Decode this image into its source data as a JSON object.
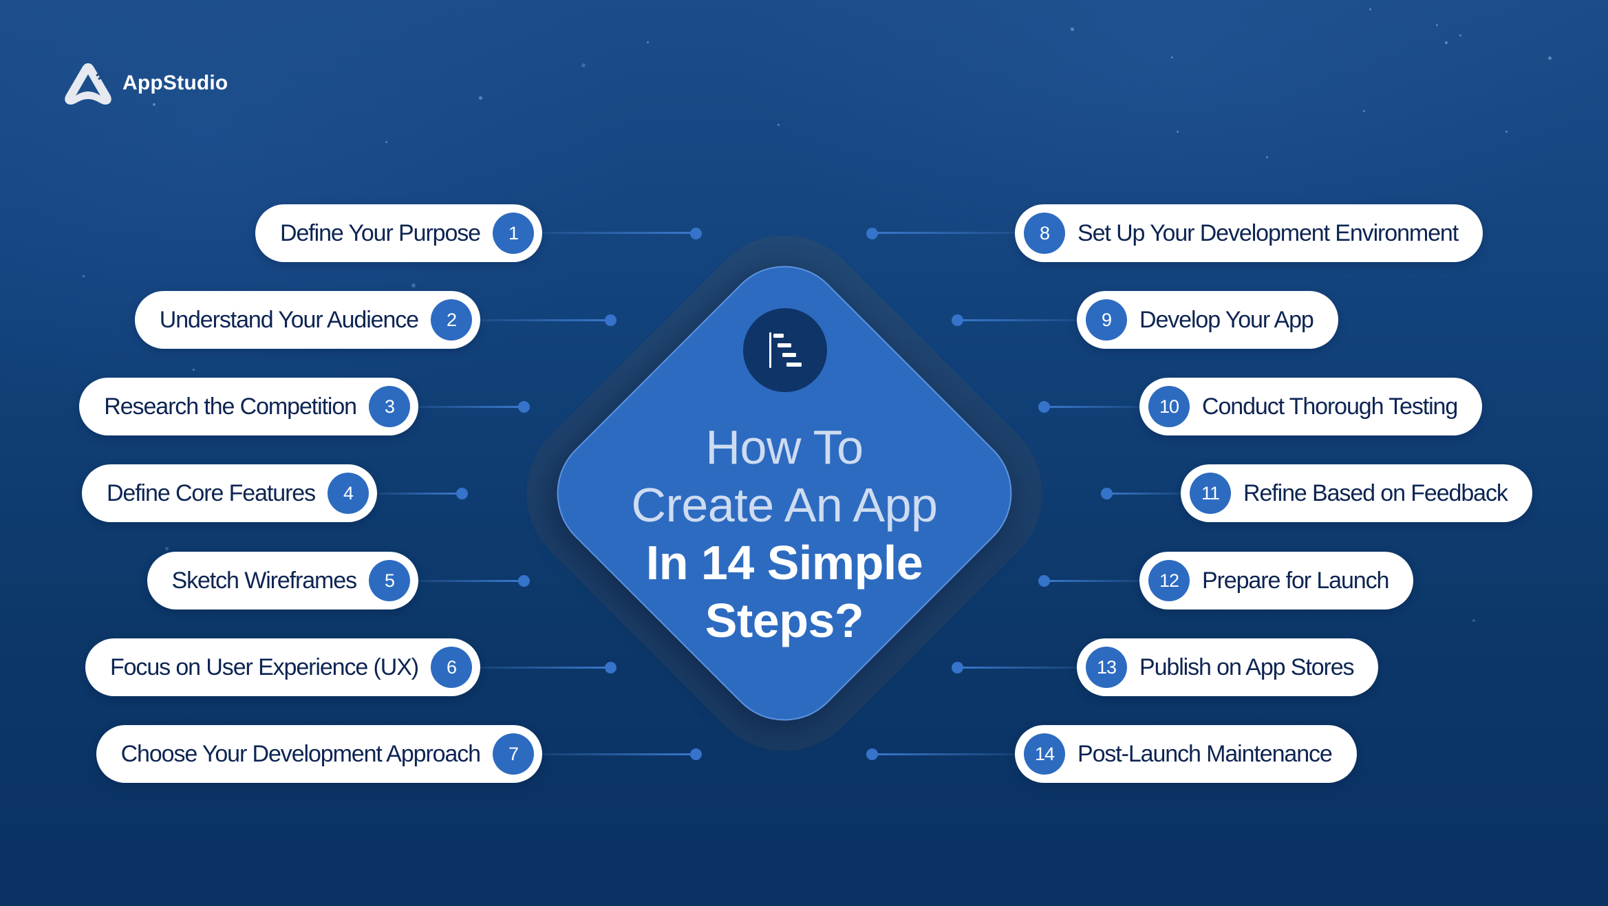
{
  "brand": {
    "name": "AppStudio",
    "logo_icon": "appstudio-triangle-logo"
  },
  "center": {
    "icon": "steps-gantt-icon",
    "title_line1": "How To",
    "title_line2": "Create An App",
    "title_line3": "In 14 Simple",
    "title_line4": "Steps?"
  },
  "colors": {
    "background_top": "#1c4d89",
    "background_bottom": "#0a3263",
    "diamond": "#2d6bc1",
    "step_badge": "#2d6bc1",
    "step_text": "#0d2452",
    "title_light": "#cedcf1",
    "pill": "#ffffff"
  },
  "steps_left": [
    {
      "number": "1",
      "label": "Define Your Purpose"
    },
    {
      "number": "2",
      "label": "Understand Your Audience"
    },
    {
      "number": "3",
      "label": "Research the Competition"
    },
    {
      "number": "4",
      "label": "Define Core Features"
    },
    {
      "number": "5",
      "label": "Sketch Wireframes"
    },
    {
      "number": "6",
      "label": "Focus on User Experience (UX)"
    },
    {
      "number": "7",
      "label": "Choose Your Development Approach"
    }
  ],
  "steps_right": [
    {
      "number": "8",
      "label": "Set Up Your Development Environment"
    },
    {
      "number": "9",
      "label": "Develop Your App"
    },
    {
      "number": "10",
      "label": "Conduct Thorough Testing"
    },
    {
      "number": "11",
      "label": "Refine Based on Feedback"
    },
    {
      "number": "12",
      "label": "Prepare for Launch"
    },
    {
      "number": "13",
      "label": "Publish on App Stores"
    },
    {
      "number": "14",
      "label": "Post-Launch Maintenance"
    }
  ]
}
